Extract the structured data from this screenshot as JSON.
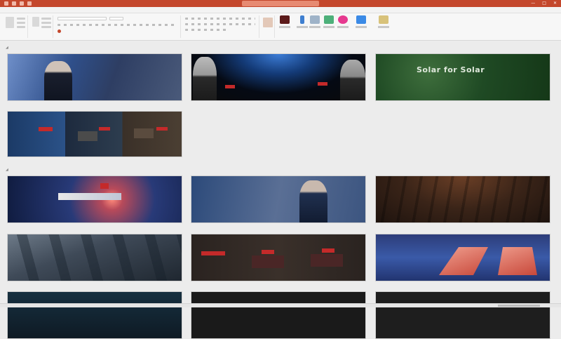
{
  "window": {
    "title": "",
    "search_placeholder": ""
  },
  "ribbon": {
    "tabs": [
      "",
      "",
      "",
      "",
      "",
      "",
      "",
      "",
      "",
      "",
      "",
      ""
    ]
  },
  "sections": [
    {
      "label": ""
    },
    {
      "label": ""
    }
  ],
  "slides": {
    "s1": {
      "title": "",
      "subtitle": ""
    },
    "s2": {
      "title": ""
    },
    "s3": {
      "title": "Solar for Solar"
    },
    "s5": {
      "title": ""
    },
    "s6": {
      "title": "",
      "subtitle": ""
    },
    "s7": {
      "title": ""
    },
    "s8": {
      "title": ""
    },
    "s10": {
      "title": ""
    }
  },
  "colors": {
    "accent": "#c4472c",
    "ribbon_bg": "#f7f7f7",
    "canvas_bg": "#ececec"
  }
}
